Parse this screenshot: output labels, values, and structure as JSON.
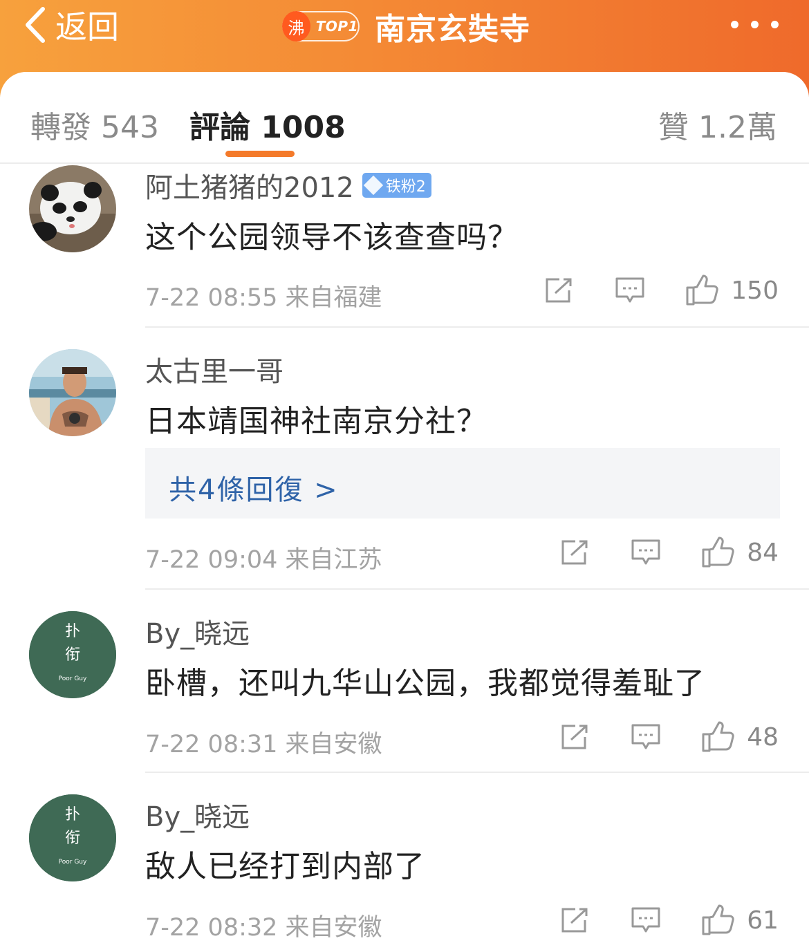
{
  "header": {
    "back_label": "返回",
    "hot_glyph": "沸",
    "hot_label": "TOP1",
    "title": "南京玄奘寺",
    "accent": "#f48a35"
  },
  "tabs": {
    "repost": "轉發 543",
    "comment": "評論 1008",
    "like": "贊 1.2萬",
    "active_color": "#f47a2a"
  },
  "comments": [
    {
      "name": "阿土猪猪的2012",
      "badge": "铁粉2",
      "text": "这个公园领导不该查查吗？",
      "meta": "7-22 08:55  来自福建",
      "likes": "150"
    },
    {
      "name": "太古里一哥",
      "text": "日本靖国神社南京分社？",
      "replies": "共4條回復 >",
      "meta": "7-22 09:04  来自江苏",
      "likes": "84"
    },
    {
      "name": "By_晓远",
      "text": "卧槽，还叫九华山公园，我都觉得羞耻了",
      "meta": "7-22 08:31  来自安徽",
      "likes": "48"
    },
    {
      "name": "By_晓远",
      "text": "敌人已经打到内部了",
      "meta": "7-22 08:32  来自安徽",
      "likes": "61"
    }
  ],
  "avatar_text": {
    "line1": "扑",
    "line2": "衔",
    "line3": "Poor Guy",
    "bg": "#3f6a55"
  }
}
